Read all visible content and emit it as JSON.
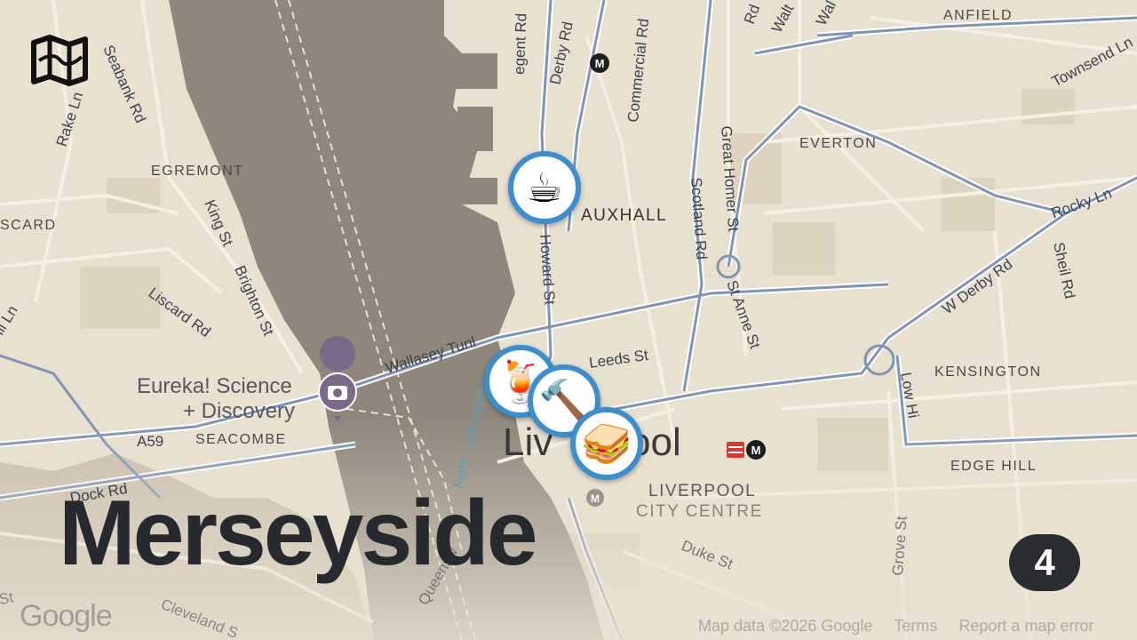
{
  "region_title": "Merseyside",
  "marker_count": "4",
  "attribution": {
    "map_data": "Map data ©2026 Google",
    "terms": "Terms",
    "report": "Report a map error"
  },
  "google_logo": "Google",
  "app_logo_icon": "folded-map-icon",
  "markers": [
    {
      "name": "coffee",
      "icon": "coffee-cup-icon",
      "glyph": "☕"
    },
    {
      "name": "mixer",
      "icon": "stand-mixer-icon",
      "glyph": "🍹"
    },
    {
      "name": "auction",
      "icon": "gavel-icon",
      "glyph": "🔨"
    },
    {
      "name": "sandwich",
      "icon": "sandwich-icon",
      "glyph": "🥪"
    }
  ],
  "map_labels": {
    "anfield": "ANFIELD",
    "everton": "EVERTON",
    "egremont": "EGREMONT",
    "liscard": "SCARD",
    "vauxhall": "AUXHALL",
    "kensington": "KENSINGTON",
    "seacombe": "SEACOMBE",
    "edge_hill": "EDGE HILL",
    "liverpool_city_centre_1": "LIVERPOOL",
    "liverpool_city_centre_2": "CITY CENTRE",
    "liverpool_1": "Liv",
    "liverpool_2": "ool",
    "eureka_1": "Eureka! Science",
    "eureka_2": "+ Discovery"
  },
  "roads": {
    "regent_rd": "egent Rd",
    "derby_rd": "Derby Rd",
    "commercial_rd": "Commercial Rd",
    "walton": "Walt",
    "walton2": "Wal",
    "rd_top": "Rd",
    "townsend": "Townsend Ln",
    "rake_ln": "Rake Ln",
    "seabank": "Seabank Rd",
    "great_homer": "Great Homer St",
    "scotland_rd": "Scotland Rd",
    "howard_st": "Howard St",
    "king_st": "King St",
    "brighton_st": "Brighton St",
    "liscard_rd": "Liscard Rd",
    "hill_ln": "ill Ln",
    "rocky_ln": "Rocky Ln",
    "sheil_rd": "Sheil Rd",
    "w_derby_rd": "W Derby Rd",
    "st_anne_st": "St Anne St",
    "leeds_st": "Leeds St",
    "wallasey_tunl": "Wallasey Tunl",
    "low_hill": "Low Hi",
    "a59": "A59",
    "dock_rd": "Dock Rd",
    "duke_st": "Duke St",
    "grove_st": "Grove St",
    "queensway": "Queensw",
    "ferry": "Ferry - Birkenhead",
    "cleveland": "Cleveland S",
    "st_left": "St"
  },
  "colors": {
    "land": "#e9e1d0",
    "water": "#8d877c",
    "road_major": "#7e95b8",
    "road_minor": "#f6f0e2",
    "marker_ring": "#3b8fd1",
    "title": "#262a2e",
    "badge": "#2a2d31"
  }
}
